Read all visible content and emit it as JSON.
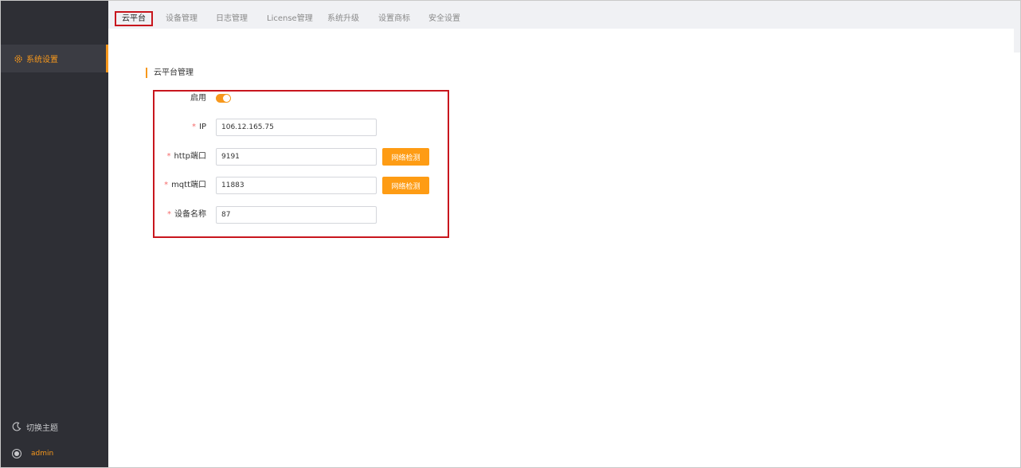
{
  "sidebar": {
    "menu": [
      {
        "label": "系统设置",
        "icon": "gear-icon",
        "active": true
      }
    ],
    "theme_switch": {
      "label": "切换主题",
      "icon": "moon-icon"
    },
    "user": {
      "name": "admin",
      "icon": "user-avatar-icon"
    }
  },
  "tabs": [
    {
      "label": "云平台",
      "active": true
    },
    {
      "label": "设备管理"
    },
    {
      "label": "日志管理"
    },
    {
      "label": "License管理"
    },
    {
      "label": "系统升级"
    },
    {
      "label": "设置商标"
    },
    {
      "label": "安全设置"
    }
  ],
  "section": {
    "title": "云平台管理"
  },
  "form": {
    "enable": {
      "label": "启用",
      "value": true
    },
    "ip": {
      "required_mark": "*",
      "label": "IP",
      "value": "106.12.165.75"
    },
    "http_port": {
      "required_mark": "*",
      "label": "http端口",
      "value": "9191",
      "button": "网络检测"
    },
    "mqtt_port": {
      "required_mark": "*",
      "label": "mqtt端口",
      "value": "11883",
      "button": "网络检测"
    },
    "device_name": {
      "required_mark": "*",
      "label": "设备名称",
      "value": "87"
    }
  },
  "colors": {
    "accent": "#f7981c",
    "button": "#fe9c14",
    "sidebar_bg": "#2e2f35",
    "highlight_border": "#c8161d",
    "required": "#f56c6c"
  }
}
